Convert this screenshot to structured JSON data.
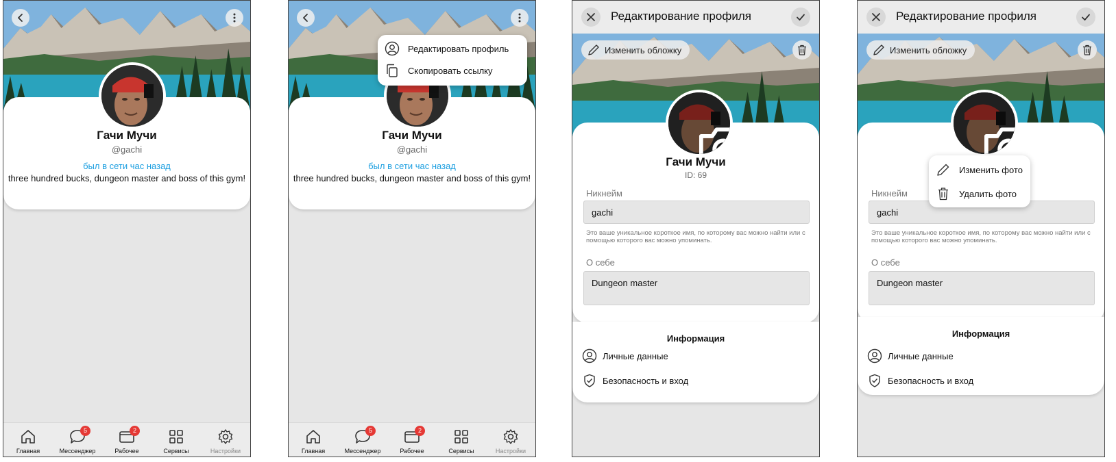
{
  "profile": {
    "name": "Гачи Мучи",
    "handle": "@gachi",
    "status": "был в сети час назад",
    "bio": "three hundred bucks, dungeon master and boss of this gym!",
    "id_label": "ID: 69"
  },
  "icons": {
    "back": "chevron-left-icon",
    "more": "more-vertical-icon",
    "close": "close-icon",
    "confirm": "check-icon",
    "camera": "camera-icon",
    "pencil": "pencil-icon",
    "trash": "trash-icon",
    "user": "user-circle-icon",
    "copy": "copy-icon",
    "shield": "shield-check-icon",
    "home": "home-icon",
    "messenger": "chat-bubble-icon",
    "workspace": "folder-icon",
    "services": "grid-icon",
    "settings": "gear-icon"
  },
  "nav": {
    "items": [
      {
        "label": "Главная",
        "badge": null
      },
      {
        "label": "Мессенджер",
        "badge": "5"
      },
      {
        "label": "Рабочее",
        "badge": "2"
      },
      {
        "label": "Сервисы",
        "badge": null
      },
      {
        "label": "Настройки",
        "badge": null
      }
    ]
  },
  "menu": {
    "edit_profile": "Редактировать профиль",
    "copy_link": "Скопировать ссылку"
  },
  "edit": {
    "title": "Редактирование профиля",
    "change_cover": "Изменить обложку",
    "nickname_label": "Никнейм",
    "nickname_value": "gachi",
    "nickname_hint": "Это ваше уникальное короткое имя, по которому вас можно найти или с помощью которого вас можно упоминать.",
    "about_label": "О себе",
    "about_value": "Dungeon master",
    "info_title": "Информация",
    "personal_data": "Личные данные",
    "security": "Безопасность и вход"
  },
  "photo_menu": {
    "change_photo": "Изменить фото",
    "delete_photo": "Удалить фото"
  },
  "colors": {
    "link": "#1a9ee0",
    "badge": "#e53935",
    "background": "#e6e6e6",
    "card": "#ffffff"
  }
}
